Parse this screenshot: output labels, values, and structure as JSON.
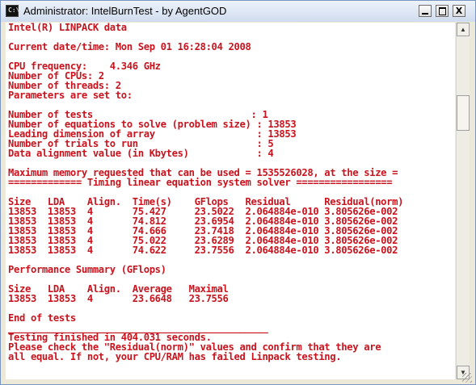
{
  "window": {
    "title": "Administrator:  IntelBurnTest - by AgentGOD",
    "icon": "console-icon",
    "icon_text": "C:\\",
    "buttons": {
      "minimize": "_",
      "maximize": "□",
      "close": "X"
    }
  },
  "console": {
    "text_color": "#c8141e",
    "background": "#ffffff",
    "lines": [
      "Intel(R) LINPACK data",
      "",
      "Current date/time: Mon Sep 01 16:28:04 2008",
      "",
      "CPU frequency:    4.346 GHz",
      "Number of CPUs: 2",
      "Number of threads: 2",
      "Parameters are set to:",
      "",
      "Number of tests                            : 1",
      "Number of equations to solve (problem size) : 13853",
      "Leading dimension of array                  : 13853",
      "Number of trials to run                     : 5",
      "Data alignment value (in Kbytes)            : 4",
      "",
      "Maximum memory requested that can be used = 1535526028, at the size =",
      "============= Timing linear equation system solver =================",
      "",
      "Size   LDA    Align.  Time(s)    GFlops   Residual      Residual(norm)",
      "13853  13853  4       75.427     23.5022  2.064884e-010 3.805626e-002",
      "13853  13853  4       74.812     23.6954  2.064884e-010 3.805626e-002",
      "13853  13853  4       74.666     23.7418  2.064884e-010 3.805626e-002",
      "13853  13853  4       75.022     23.6289  2.064884e-010 3.805626e-002",
      "13853  13853  4       74.622     23.7556  2.064884e-010 3.805626e-002",
      "",
      "Performance Summary (GFlops)",
      "",
      "Size   LDA    Align.  Average   Maximal",
      "13853  13853  4       23.6648   23.7556",
      "",
      "End of tests",
      "______________________________________________",
      "Testing finished in 404.031 seconds.",
      "Please check the \"Residual(norm)\" values and confirm that they are",
      "all equal. If not, your CPU/RAM has failed Linpack testing.",
      ""
    ]
  },
  "scrollbar": {
    "up": "▲",
    "down": "▼",
    "position": 0.2
  }
}
